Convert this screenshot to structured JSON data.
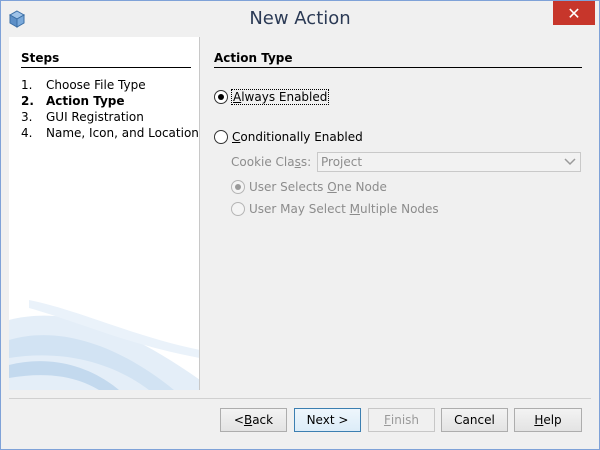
{
  "window": {
    "title": "New Action"
  },
  "steps": {
    "heading": "Steps",
    "items": [
      {
        "num": "1.",
        "label": "Choose File Type",
        "current": false
      },
      {
        "num": "2.",
        "label": "Action Type",
        "current": true
      },
      {
        "num": "3.",
        "label": "GUI Registration",
        "current": false
      },
      {
        "num": "4.",
        "label": "Name, Icon, and Location",
        "current": false
      }
    ]
  },
  "main": {
    "heading": "Action Type",
    "always_enabled": {
      "prefix": "",
      "mnemonic": "A",
      "rest": "lways Enabled",
      "checked": true
    },
    "conditionally_enabled": {
      "prefix": "",
      "mnemonic": "C",
      "rest": "onditionally Enabled",
      "checked": false
    },
    "cookie_class": {
      "label_prefix": "Cookie Cla",
      "label_mnemonic": "s",
      "label_rest": "s:",
      "value": "Project"
    },
    "one_node": {
      "prefix": "User Selects ",
      "mnemonic": "O",
      "rest": "ne Node",
      "checked": true
    },
    "multiple_nodes": {
      "prefix": "User May Select ",
      "mnemonic": "M",
      "rest": "ultiple Nodes",
      "checked": false
    }
  },
  "buttons": {
    "back": {
      "prefix": "< ",
      "mnemonic": "B",
      "rest": "ack"
    },
    "next": {
      "label": "Next >"
    },
    "finish": {
      "prefix": "",
      "mnemonic": "F",
      "rest": "inish"
    },
    "cancel": {
      "label": "Cancel"
    },
    "help": {
      "prefix": "",
      "mnemonic": "H",
      "rest": "elp"
    }
  },
  "colors": {
    "close_button": "#c7362b",
    "default_button_border": "#3c7fb1",
    "swoosh": "#cfe1f1"
  },
  "icons": {
    "app": "cube-icon",
    "close": "close-icon",
    "dropdown": "chevron-down-icon"
  }
}
